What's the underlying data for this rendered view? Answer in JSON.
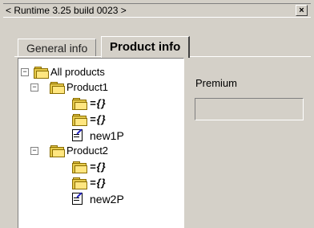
{
  "window": {
    "title": "< Runtime 3.25 build 0023 >",
    "close_label": "×"
  },
  "tabs": [
    {
      "label": "General info",
      "active": false
    },
    {
      "label": "Product info",
      "active": true
    }
  ],
  "tree": {
    "root": {
      "label": "All products",
      "expanded": true,
      "expander": "−"
    },
    "products": [
      {
        "label": "Product1",
        "expanded": true,
        "expander": "−",
        "children": [
          {
            "icon": "folder-icon",
            "label": "={}"
          },
          {
            "icon": "folder-icon",
            "label": "={}"
          },
          {
            "icon": "document-edit-icon",
            "label": "new1P"
          }
        ]
      },
      {
        "label": "Product2",
        "expanded": true,
        "expander": "−",
        "children": [
          {
            "icon": "folder-icon",
            "label": "={}"
          },
          {
            "icon": "folder-icon",
            "label": "={}"
          },
          {
            "icon": "document-edit-icon",
            "label": "new2P"
          }
        ]
      }
    ]
  },
  "detail": {
    "premium_label": "Premium",
    "premium_value": ""
  }
}
